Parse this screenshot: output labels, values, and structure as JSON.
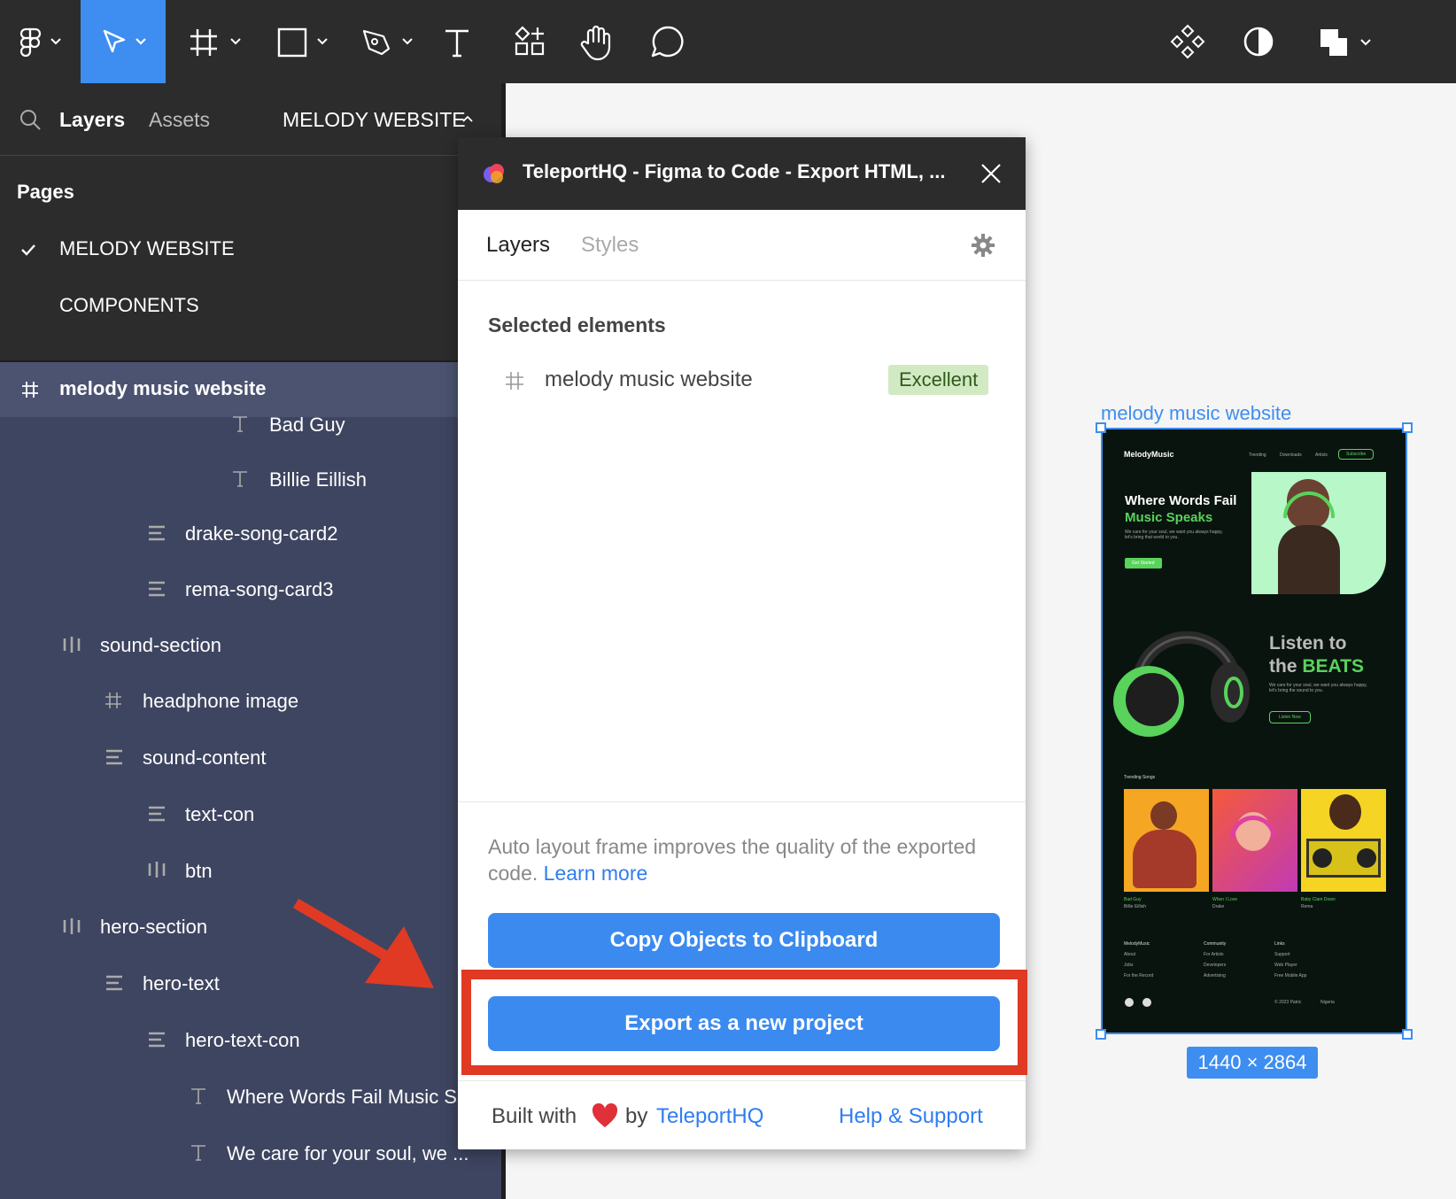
{
  "toolbar": {
    "tools": [
      "figma-menu",
      "move",
      "frame",
      "rectangle",
      "pen",
      "text",
      "resources",
      "hand",
      "comment"
    ]
  },
  "left_panel": {
    "tab_layers": "Layers",
    "tab_assets": "Assets",
    "page_dropdown": "MELODY WEBSITE",
    "pages_heading": "Pages",
    "pages": [
      "MELODY WEBSITE",
      "COMPONENTS"
    ],
    "layers": [
      {
        "label": "melody music website",
        "icon": "frame-icon"
      },
      {
        "label": "Bad Guy",
        "icon": "text-icon"
      },
      {
        "label": "Billie Eillish",
        "icon": "text-icon"
      },
      {
        "label": "drake-song-card2",
        "icon": "vertical-autolayout-icon"
      },
      {
        "label": "rema-song-card3",
        "icon": "vertical-autolayout-icon"
      },
      {
        "label": "sound-section",
        "icon": "horizontal-autolayout-icon"
      },
      {
        "label": "headphone image",
        "icon": "frame-icon"
      },
      {
        "label": "sound-content",
        "icon": "vertical-autolayout-icon"
      },
      {
        "label": "text-con",
        "icon": "vertical-autolayout-icon"
      },
      {
        "label": "btn",
        "icon": "horizontal-autolayout-icon"
      },
      {
        "label": "hero-section",
        "icon": "horizontal-autolayout-icon"
      },
      {
        "label": "hero-text",
        "icon": "vertical-autolayout-icon"
      },
      {
        "label": "hero-text-con",
        "icon": "vertical-autolayout-icon"
      },
      {
        "label": "Where Words Fail Music S",
        "icon": "text-icon"
      },
      {
        "label": "We care for your soul, we ...",
        "icon": "text-icon"
      }
    ]
  },
  "plugin": {
    "title": "TeleportHQ - Figma to Code - Export HTML, ...",
    "tab_layers": "Layers",
    "tab_styles": "Styles",
    "selected_heading": "Selected elements",
    "selected_item": "melody music website",
    "quality_badge": "Excellent",
    "hint_text": "Auto layout frame improves the quality of the exported code.",
    "learn_more": "Learn more",
    "copy_button": "Copy Objects to Clipboard",
    "export_button": "Export as a new project",
    "built_with": "Built with",
    "by": "by",
    "brand_link": "TeleportHQ",
    "help_link": "Help & Support"
  },
  "canvas": {
    "frame_label": "melody music website",
    "dimensions": "1440 × 2864",
    "preview": {
      "logo": "MelodyMusic",
      "nav": [
        "Trending",
        "Downloads",
        "Artists",
        "Subscribe"
      ],
      "hero_line1": "Where Words Fail",
      "hero_line2": "Music Speaks",
      "hero_body": "We care for your soul, we want you always happy, let's bring that world to you.",
      "hero_btn": "Get Started",
      "listen_line1": "Listen to",
      "listen_line2": "the ",
      "listen_accent": "BEATS",
      "listen_body": "We care for your soul, we want you always happy, let's bring the sound to you.",
      "listen_btn": "Listen Now",
      "trending_heading": "Trending Songs",
      "songs": [
        {
          "title": "Bad Guy",
          "artist": "Billie Eillish"
        },
        {
          "title": "When I Love",
          "artist": "Drake"
        },
        {
          "title": "Baby Clam Down",
          "artist": "Rema"
        }
      ],
      "footer_cols": [
        {
          "head": "MelodyMusic",
          "items": [
            "About",
            "Jobs",
            "For the Record"
          ]
        },
        {
          "head": "Community",
          "items": [
            "For Artists",
            "Developers",
            "Advertising"
          ]
        },
        {
          "head": "Links",
          "items": [
            "Support",
            "Web Player",
            "Free Mobile App"
          ]
        }
      ],
      "copyright": "© 2023 Patric",
      "location": "Nigeria"
    }
  },
  "colors": {
    "accent": "#3d8ef0",
    "highlight": "#e03a24",
    "badge_bg": "#d2eac3",
    "preview_green": "#59d35b"
  }
}
